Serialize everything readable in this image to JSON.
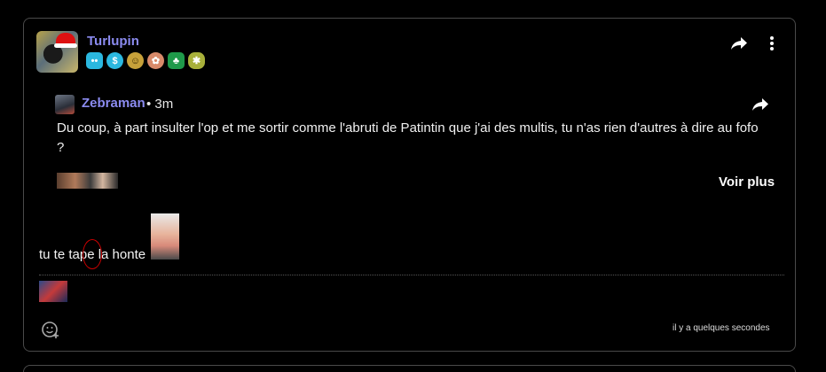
{
  "post": {
    "author": "Turlupin",
    "badges": [
      {
        "icon": "dots-badge-icon",
        "glyph": "••"
      },
      {
        "icon": "dollar-badge-icon",
        "glyph": "$"
      },
      {
        "icon": "smiley-badge-icon",
        "glyph": "☺"
      },
      {
        "icon": "flower-badge-icon",
        "glyph": "✿"
      },
      {
        "icon": "cards-badge-icon",
        "glyph": "♣"
      },
      {
        "icon": "bug-badge-icon",
        "glyph": "✱"
      }
    ],
    "quote": {
      "author": "Zebraman",
      "time": "• 3m",
      "text": "Du coup, à part insulter l'op et me sortir comme l'abruti de Patintin que j'ai des multis, tu n'as rien d'autres à dire au fofo ?",
      "see_more": "Voir plus"
    },
    "reply_text": "tu te tape la honte",
    "timestamp": "il y a quelques secondes"
  },
  "colors": {
    "username": "#8b8bf0",
    "background": "#000000",
    "border": "#4a4a4a"
  }
}
